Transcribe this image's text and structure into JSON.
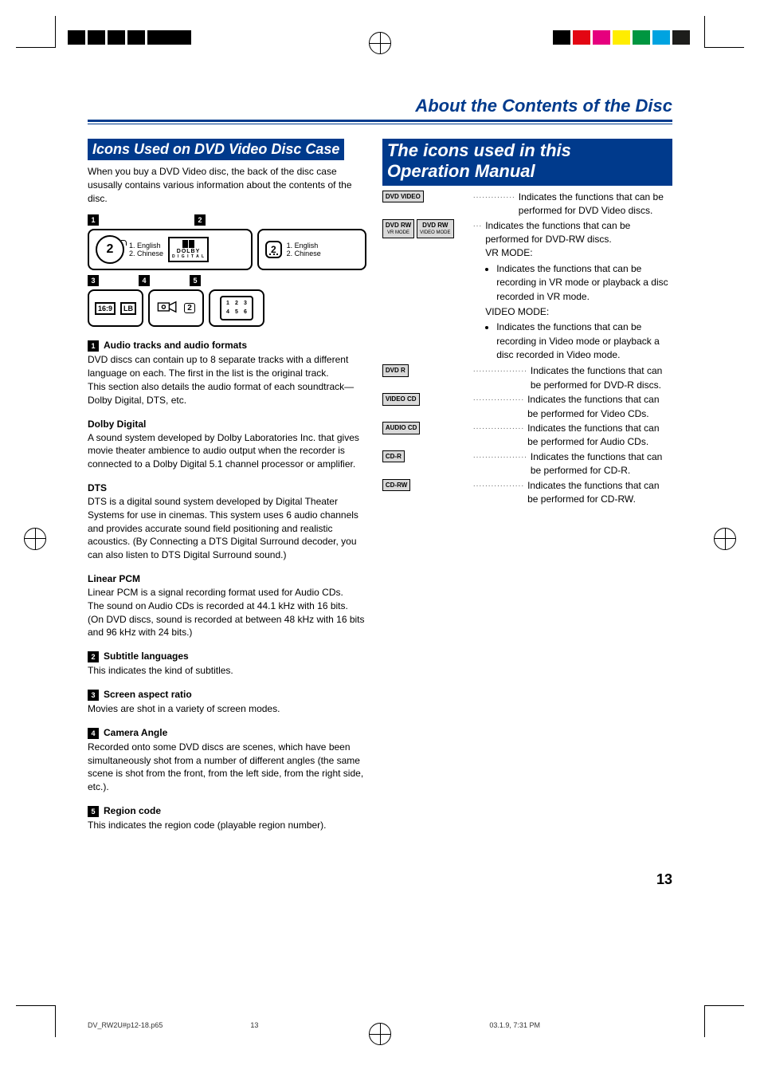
{
  "page": {
    "title": "About the Contents of the Disc",
    "page_number": "13",
    "footer_file": "DV_RW2U#p12-18.p65",
    "footer_page": "13",
    "footer_time": "03.1.9, 7:31 PM"
  },
  "left": {
    "heading": "Icons Used on DVD Video Disc Case",
    "intro": "When you buy a DVD Video disc, the back of the disc case ususally contains various information about the contents of the disc.",
    "diagram": {
      "d1_num": "1",
      "d2_num": "2",
      "d3_num": "3",
      "d4_num": "4",
      "d5_num": "5",
      "big2": "2",
      "lang1": "1. English",
      "lang2": "2. Chinese",
      "dolby_top": "DOLBY",
      "dolby_bottom": "D I G I T A L",
      "sub_badge": "2",
      "sub_lang1": "1. English",
      "sub_lang2": "2. Chinese",
      "ratio": "16:9",
      "ratio_lb": "LB",
      "angle": "2",
      "region_digits": [
        "1",
        "2",
        "3",
        "4",
        "5",
        "6"
      ]
    },
    "items": [
      {
        "num": "1",
        "title": "Audio tracks and audio formats",
        "text": "DVD discs can contain up to 8 separate tracks with a different language on each. The first in the list is the original track.\nThis section also details the audio format of each soundtrack—Dolby Digital, DTS, etc."
      },
      {
        "title": "Dolby Digital",
        "text": "A sound system developed by Dolby Laboratories Inc. that gives movie theater ambience to audio output when the recorder is connected to a Dolby Digital 5.1 channel processor or amplifier."
      },
      {
        "title": "DTS",
        "text": "DTS is a digital sound system developed by Digital Theater Systems for use in cinemas. This system uses 6 audio channels and provides accurate sound field positioning and realistic acoustics. (By Connecting a DTS Digital Surround decoder, you can also listen to DTS Digital Surround sound.)"
      },
      {
        "title": "Linear PCM",
        "text": "Linear PCM is a signal recording format used for Audio CDs.\nThe sound on Audio CDs is recorded at 44.1 kHz with 16 bits. (On DVD discs, sound is recorded at between 48 kHz with 16 bits and 96 kHz with 24 bits.)"
      },
      {
        "num": "2",
        "title": "Subtitle languages",
        "text": "This indicates the kind of subtitles."
      },
      {
        "num": "3",
        "title": "Screen aspect ratio",
        "text": "Movies are shot in a variety of screen modes."
      },
      {
        "num": "4",
        "title": "Camera Angle",
        "text": "Recorded onto some DVD discs are scenes, which have been simultaneously shot from a number of different angles (the same scene is shot from the front, from the left side, from the right side, etc.)."
      },
      {
        "num": "5",
        "title": "Region code",
        "text": "This indicates the region code (playable region number)."
      }
    ]
  },
  "right": {
    "heading_l1": "The icons used in this",
    "heading_l2": "Operation Manual",
    "rows": [
      {
        "badges": [
          {
            "t": "DVD VIDEO"
          }
        ],
        "text": "Indicates the functions that can be performed for DVD Video discs."
      },
      {
        "badges": [
          {
            "t": "DVD RW",
            "s": "VR MODE"
          },
          {
            "t": "DVD RW",
            "s": "VIDEO MODE"
          }
        ],
        "text": "Indicates the functions that can be performed for DVD-RW discs.",
        "extra": [
          {
            "h": "VR MODE:",
            "li": "Indicates the functions that can be recording in VR mode or playback a disc recorded in VR mode."
          },
          {
            "h": "VIDEO MODE:",
            "li": "Indicates the functions that can be recording in Video mode or playback a disc recorded in Video mode."
          }
        ]
      },
      {
        "badges": [
          {
            "t": "DVD R"
          }
        ],
        "text": "Indicates the functions that can be performed for DVD-R discs."
      },
      {
        "badges": [
          {
            "t": "VIDEO CD"
          }
        ],
        "text": "Indicates the functions that can be performed for Video CDs."
      },
      {
        "badges": [
          {
            "t": "AUDIO CD"
          }
        ],
        "text": "Indicates the functions that can be performed for Audio CDs."
      },
      {
        "badges": [
          {
            "t": "CD-R"
          }
        ],
        "text": "Indicates the functions that can be performed for CD-R."
      },
      {
        "badges": [
          {
            "t": "CD-RW"
          }
        ],
        "text": "Indicates the functions that can be performed for CD-RW."
      }
    ]
  }
}
